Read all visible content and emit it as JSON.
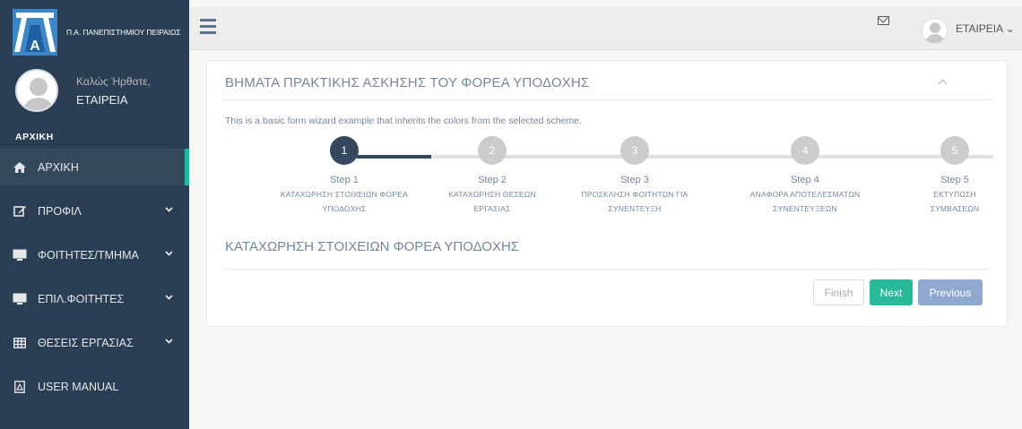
{
  "sidebar": {
    "logo_text": "Π.Α. ΠΑΝΕΠΙΣΤΗΜΙΟΥ ΠΕΙΡΑΙΩΣ",
    "welcome": "Καλώς Ήρθατε,",
    "username": "ΕΤΑΙΡΕΙΑ",
    "section_title": "ΑΡΧΙΚΗ",
    "items": [
      {
        "label": "ΑΡΧΙΚΗ",
        "icon": "home-icon",
        "active": true,
        "has_submenu": false
      },
      {
        "label": "ΠΡΟΦΙΛ",
        "icon": "edit-icon",
        "active": false,
        "has_submenu": true
      },
      {
        "label": "ΦΟΙΤΗΤΕΣ/ΤΜΗΜΑ",
        "icon": "monitor-icon",
        "active": false,
        "has_submenu": true
      },
      {
        "label": "ΕΠΙΛ.ΦΟΙΤΗΤΕΣ",
        "icon": "monitor-icon",
        "active": false,
        "has_submenu": true
      },
      {
        "label": "ΘΕΣΕΙΣ ΕΡΓΑΣΙΑΣ",
        "icon": "table-icon",
        "active": false,
        "has_submenu": true
      },
      {
        "label": "USER MANUAL",
        "icon": "pdf-icon",
        "active": false,
        "has_submenu": false
      }
    ]
  },
  "topbar": {
    "user_label": "ΕΤΑΙΡΕΙΑ ⌄",
    "icons": [
      "menu-icon",
      "mail-icon",
      "user-avatar"
    ]
  },
  "panel": {
    "title": "ΒΗΜΑΤΑ ΠΡΑΚΤΙΚΗΣ ΑΣΚΗΣΗΣ ΤΟΥ ΦΟΡΕΑ ΥΠΟΔΟΧΗΣ",
    "intro": "This is a basic form wizard example that inherits the colors from the selected scheme.",
    "steps": [
      {
        "number": "1",
        "label": "Step 1",
        "desc": "ΚΑΤΑΧΩΡΗΣΗ ΣΤΟΙΧΕΙΩΝ ΦΟΡΕΑ ΥΠΟΔΟΧΗΣ",
        "active": true
      },
      {
        "number": "2",
        "label": "Step 2",
        "desc": "ΚΑΤΑΧΩΡΗΣΗ ΘΕΣΕΩΝ ΕΡΓΑΣΙΑΣ",
        "active": false
      },
      {
        "number": "3",
        "label": "Step 3",
        "desc": "ΠΡΟΣΚΛΗΣΗ ΦΟΙΤΗΤΩΝ ΓΙΑ ΣΥΝΕΝΤΕΥΞΗ",
        "active": false
      },
      {
        "number": "4",
        "label": "Step 4",
        "desc": "ΑΝΑΦΟΡΑ ΑΠΟΤΕΛΕΣΜΑΤΩΝ ΣΥΝΕΝΤΕΥΞΕΩΝ",
        "active": false
      },
      {
        "number": "5",
        "label": "Step 5",
        "desc": "ΕΚΤΥΠΩΣΗ ΣΥΜΒΑΣΕΩΝ",
        "active": false
      }
    ],
    "content_title": "ΚΑΤΑΧΩΡΗΣΗ ΣΤΟΙΧΕΙΩΝ ΦΟΡΕΑ ΥΠΟΔΟΧΗΣ",
    "buttons": {
      "finish": "Finish",
      "next": "Next",
      "previous": "Previous"
    }
  },
  "colors": {
    "sidebar_bg": "#2a3f54",
    "accent": "#1abb9c",
    "next_button": "#26b99a",
    "previous_button": "#8fa8cf",
    "active_step": "#34495e"
  }
}
